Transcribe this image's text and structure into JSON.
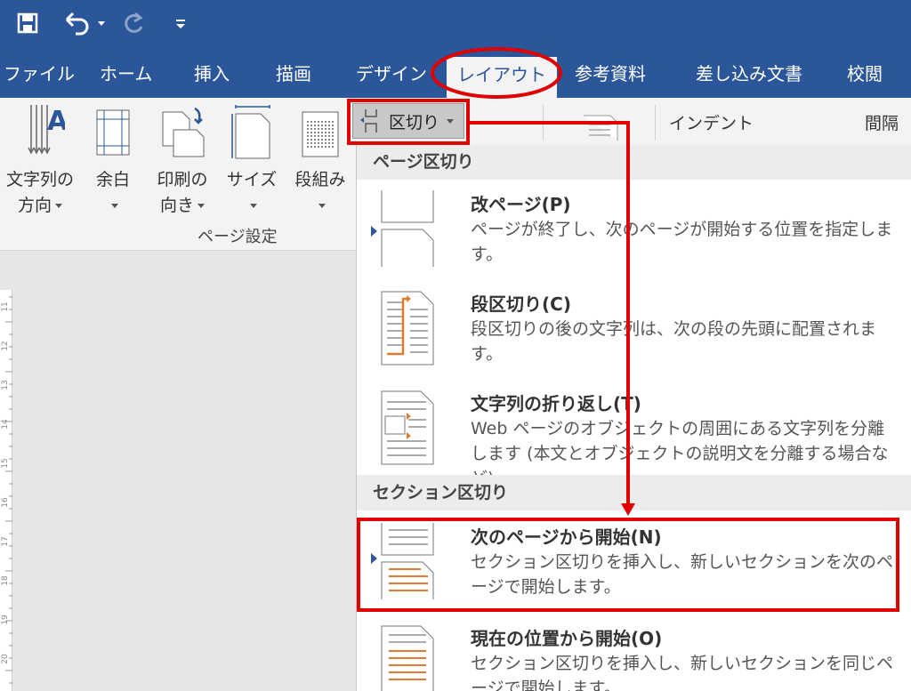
{
  "quick_access": {
    "save_icon": "save-icon",
    "undo_icon": "undo-icon",
    "redo_icon": "redo-icon",
    "customize_icon": "customize-icon"
  },
  "tabs": [
    {
      "label": "ファイル"
    },
    {
      "label": "ホーム"
    },
    {
      "label": "挿入"
    },
    {
      "label": "描画"
    },
    {
      "label": "デザイン"
    },
    {
      "label": "レイアウト"
    },
    {
      "label": "参考資料"
    },
    {
      "label": "差し込み文書"
    },
    {
      "label": "校閲"
    }
  ],
  "ribbon": {
    "text_direction": {
      "line1": "文字列の",
      "line2": "方向"
    },
    "margins": {
      "line1": "余白"
    },
    "orientation": {
      "line1": "印刷の",
      "line2": "向き"
    },
    "size": {
      "line1": "サイズ"
    },
    "columns": {
      "line1": "段組み"
    },
    "group_label": "ページ設定",
    "breaks_label": "区切り",
    "indent_label": "インデント",
    "spacing_label": "間隔"
  },
  "ruler": {
    "numbers": [
      "11",
      "12",
      "13",
      "14",
      "15",
      "16",
      "17",
      "18",
      "19",
      "20"
    ]
  },
  "menu": {
    "page_breaks_header": "ページ区切り",
    "section_breaks_header": "セクション区切り",
    "items": [
      {
        "title": "改ページ(P)",
        "desc": "ページが終了し、次のページが開始する位置を指定します。"
      },
      {
        "title": "段区切り(C)",
        "desc": "段区切りの後の文字列は、次の段の先頭に配置されます。"
      },
      {
        "title": "文字列の折り返し(T)",
        "desc": "Web ページのオブジェクトの周囲にある文字列を分離します (本文とオブジェクトの説明文を分離する場合など)。"
      },
      {
        "title": "次のページから開始(N)",
        "desc": "セクション区切りを挿入し、新しいセクションを次のページで開始します。"
      },
      {
        "title": "現在の位置から開始(O)",
        "desc": "セクション区切りを挿入し、新しいセクションを同じページで開始します。"
      }
    ]
  },
  "colors": {
    "accent": "#2b579a",
    "annotation": "#e00000",
    "orange": "#e07a2e"
  }
}
